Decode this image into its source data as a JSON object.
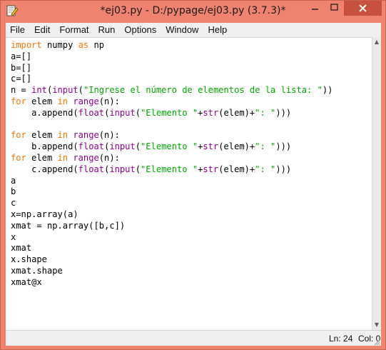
{
  "window": {
    "title": "*ej03.py - D:/pypage/ej03.py (3.7.3)*",
    "minimize_icon": "minimize-icon",
    "maximize_icon": "maximize-icon",
    "close_icon": "close-icon"
  },
  "menu": {
    "items": [
      "File",
      "Edit",
      "Format",
      "Run",
      "Options",
      "Window",
      "Help"
    ]
  },
  "editor": {
    "lines": [
      [
        {
          "t": "import",
          "k": "kw"
        },
        {
          "t": " numpy "
        },
        {
          "t": "as",
          "k": "kw"
        },
        {
          "t": " np"
        }
      ],
      [
        {
          "t": "a=[]"
        }
      ],
      [
        {
          "t": "b=[]"
        }
      ],
      [
        {
          "t": "c=[]"
        }
      ],
      [
        {
          "t": "n = "
        },
        {
          "t": "int",
          "k": "bi"
        },
        {
          "t": "("
        },
        {
          "t": "input",
          "k": "bi"
        },
        {
          "t": "("
        },
        {
          "t": "\"Ingrese el número de elementos de la lista: \"",
          "k": "st"
        },
        {
          "t": "))"
        }
      ],
      [
        {
          "t": "for",
          "k": "kw"
        },
        {
          "t": " elem "
        },
        {
          "t": "in",
          "k": "kw"
        },
        {
          "t": " "
        },
        {
          "t": "range",
          "k": "bi"
        },
        {
          "t": "(n):"
        }
      ],
      [
        {
          "t": "    a.append("
        },
        {
          "t": "float",
          "k": "bi"
        },
        {
          "t": "("
        },
        {
          "t": "input",
          "k": "bi"
        },
        {
          "t": "("
        },
        {
          "t": "\"Elemento \"",
          "k": "st"
        },
        {
          "t": "+"
        },
        {
          "t": "str",
          "k": "bi"
        },
        {
          "t": "(elem)+"
        },
        {
          "t": "\": \"",
          "k": "st"
        },
        {
          "t": ")))"
        }
      ],
      [
        {
          "t": ""
        }
      ],
      [
        {
          "t": "for",
          "k": "kw"
        },
        {
          "t": " elem "
        },
        {
          "t": "in",
          "k": "kw"
        },
        {
          "t": " "
        },
        {
          "t": "range",
          "k": "bi"
        },
        {
          "t": "(n):"
        }
      ],
      [
        {
          "t": "    b.append("
        },
        {
          "t": "float",
          "k": "bi"
        },
        {
          "t": "("
        },
        {
          "t": "input",
          "k": "bi"
        },
        {
          "t": "("
        },
        {
          "t": "\"Elemento \"",
          "k": "st"
        },
        {
          "t": "+"
        },
        {
          "t": "str",
          "k": "bi"
        },
        {
          "t": "(elem)+"
        },
        {
          "t": "\": \"",
          "k": "st"
        },
        {
          "t": ")))"
        }
      ],
      [
        {
          "t": "for",
          "k": "kw"
        },
        {
          "t": " elem "
        },
        {
          "t": "in",
          "k": "kw"
        },
        {
          "t": " "
        },
        {
          "t": "range",
          "k": "bi"
        },
        {
          "t": "(n):"
        }
      ],
      [
        {
          "t": "    c.append("
        },
        {
          "t": "float",
          "k": "bi"
        },
        {
          "t": "("
        },
        {
          "t": "input",
          "k": "bi"
        },
        {
          "t": "("
        },
        {
          "t": "\"Elemento \"",
          "k": "st"
        },
        {
          "t": "+"
        },
        {
          "t": "str",
          "k": "bi"
        },
        {
          "t": "(elem)+"
        },
        {
          "t": "\": \"",
          "k": "st"
        },
        {
          "t": ")))"
        }
      ],
      [
        {
          "t": "a"
        }
      ],
      [
        {
          "t": "b"
        }
      ],
      [
        {
          "t": "c"
        }
      ],
      [
        {
          "t": "x=np.array(a)"
        }
      ],
      [
        {
          "t": "xmat = np.array([b,c])"
        }
      ],
      [
        {
          "t": "x"
        }
      ],
      [
        {
          "t": "xmat"
        }
      ],
      [
        {
          "t": "x.shape"
        }
      ],
      [
        {
          "t": "xmat.shape"
        }
      ],
      [
        {
          "t": "xmat@x"
        }
      ]
    ]
  },
  "status": {
    "line": "Ln: 24",
    "col": "Col: 0"
  },
  "colors": {
    "titlebar": "#f0836f",
    "close_button": "#c7503e",
    "keyword": "#ff7700",
    "builtin": "#900090",
    "string": "#00aa00"
  }
}
